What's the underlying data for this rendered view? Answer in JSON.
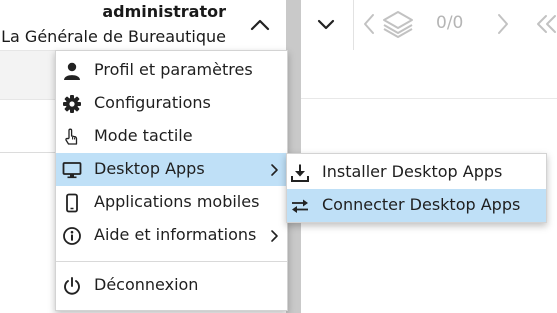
{
  "user": {
    "name": "administrator",
    "organization": "La Générale de Bureautique"
  },
  "toolbar": {
    "counter": "0/0"
  },
  "menu": {
    "items": [
      {
        "label": "Profil et paramètres",
        "icon": "user-icon"
      },
      {
        "label": "Configurations",
        "icon": "gear-icon"
      },
      {
        "label": "Mode tactile",
        "icon": "touch-hand-icon"
      },
      {
        "label": "Desktop Apps",
        "icon": "monitor-icon",
        "highlighted": true,
        "has_submenu": true
      },
      {
        "label": "Applications mobiles",
        "icon": "mobile-phone-icon"
      },
      {
        "label": "Aide et informations",
        "icon": "info-icon",
        "has_submenu": true
      },
      {
        "label": "Déconnexion",
        "icon": "power-icon"
      }
    ]
  },
  "submenu": {
    "items": [
      {
        "label": "Installer Desktop Apps",
        "icon": "download-icon"
      },
      {
        "label": "Connecter Desktop Apps",
        "icon": "swap-arrows-icon",
        "highlighted": true
      }
    ]
  },
  "colors": {
    "highlight": "#bfe0f7",
    "divider": "#c9c9c9",
    "muted": "#b5b5b5"
  }
}
